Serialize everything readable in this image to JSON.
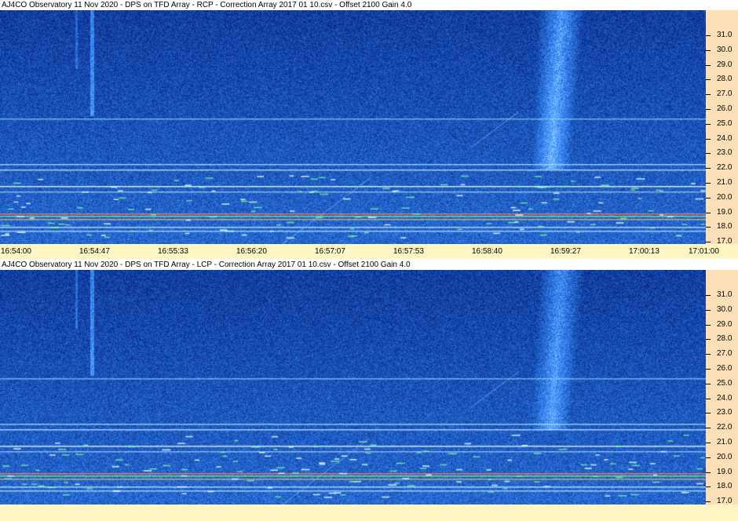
{
  "panels": [
    {
      "title": "AJ4CO Observatory 11 Nov 2020  -  DPS on TFD Array  -  RCP  -  Correction Array 2017 01 10.csv  -  Offset 2100  Gain 4.0"
    },
    {
      "title": "AJ4CO Observatory 11 Nov 2020  -  DPS on TFD Array  -  LCP  -  Correction Array 2017 01 10.csv  -  Offset 2100  Gain 4.0"
    }
  ],
  "freq_labels": [
    "31.0",
    "30.0",
    "29.0",
    "28.0",
    "27.0",
    "26.0",
    "25.0",
    "24.0",
    "23.0",
    "22.0",
    "21.0",
    "20.0",
    "19.0",
    "18.0",
    "17.0"
  ],
  "time_labels": [
    "16:54:00",
    "16:54:47",
    "16:55:33",
    "16:56:20",
    "16:57:07",
    "16:57:53",
    "16:58:40",
    "16:59:27",
    "17:00:13",
    "17:01:00"
  ],
  "colors": {
    "spectrogram_background": "#071C80",
    "frequency_axis": "#FDDFB8",
    "time_axis": "#FFF6C4"
  }
}
